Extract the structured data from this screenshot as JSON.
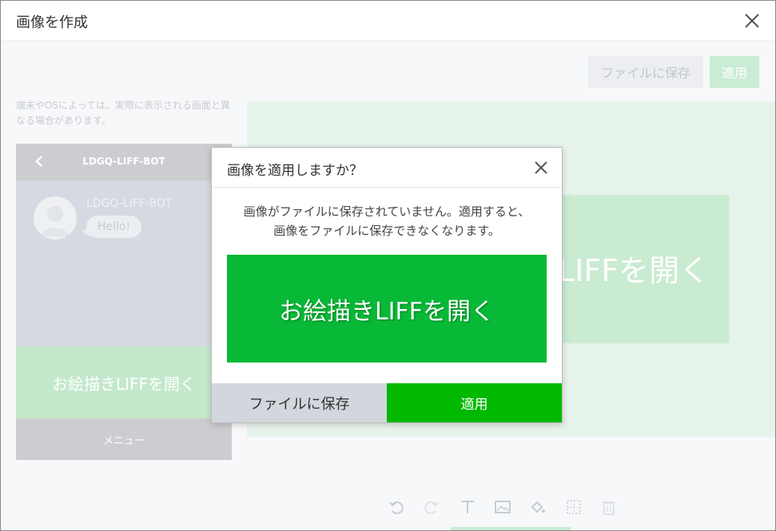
{
  "window": {
    "title": "画像を作成"
  },
  "toolbar_top": {
    "save_label": "ファイルに保存",
    "apply_label": "適用"
  },
  "preview": {
    "note": "端末やOSによっては、実際に表示される画面と異なる場合があります。",
    "bot_name_header": "LDGQ-LIFF-BOT",
    "bot_name": "LDGQ-LIFF-BOT",
    "message": "Hello!",
    "rich_menu_text": "お絵描きLIFFを開く",
    "menu_label": "メニュー"
  },
  "canvas": {
    "image_text": "お絵描きLIFFを開く"
  },
  "tools": [
    {
      "icon": "undo-icon"
    },
    {
      "icon": "redo-icon"
    },
    {
      "icon": "text-icon"
    },
    {
      "icon": "image-icon"
    },
    {
      "icon": "fill-icon"
    },
    {
      "icon": "grid-icon"
    },
    {
      "icon": "trash-icon"
    }
  ],
  "modal": {
    "title": "画像を適用しますか？",
    "message_line1": "画像がファイルに保存されていません。適用すると、",
    "message_line2": "画像をファイルに保存できなくなります。",
    "banner_text": "お絵描きLIFFを開く",
    "save_label": "ファイルに保存",
    "apply_label": "適用"
  },
  "colors": {
    "line_green": "#00b900",
    "banner_green": "#07b936",
    "save_button_gray": "#d2d6dd"
  }
}
